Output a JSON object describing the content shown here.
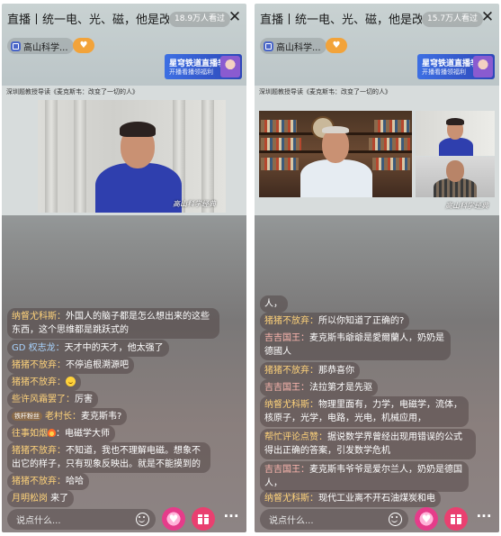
{
  "left": {
    "title": "直播丨统一电、光、磁，他是改变",
    "viewers": "18.9万人看过",
    "channel_name": "高山科学...",
    "promo": {
      "line1": "星穹铁道直播季",
      "line2": "开播看播领福利"
    },
    "video_caption": "深圳题教授导读《麦克斯韦：改变了一切的人》",
    "watermark": "高山科学经典",
    "messages": [
      {
        "user": "纳督尤科斯：",
        "text": "外国人的脑子都是怎么想出来的这些东西，这个思维都是跳跃式的",
        "color": "gold"
      },
      {
        "user": "GD 权志龙：",
        "text": "天才中的天才，他太强了",
        "color": "blue"
      },
      {
        "user": "猪猪不放弃：",
        "text": "不停追根溯源吧",
        "color": "gold"
      },
      {
        "user": "猪猪不放弃：",
        "text": "",
        "color": "gold",
        "emoji": true
      },
      {
        "user": "些许风霜罢了：",
        "text": "厉害",
        "color": "gold"
      },
      {
        "badge": "铁杆粉丝",
        "user": "老村长：",
        "text": "麦克斯韦?",
        "color": "gold"
      },
      {
        "user": "往事如烟",
        "text": "：电磁学大师",
        "color": "gold",
        "flame": true
      },
      {
        "user": "猪猪不放弃：",
        "text": "不知道，我也不理解电磁。想象不出它的样子，只有现象反映出。就是不能摸到的",
        "color": "gold"
      },
      {
        "user": "猪猪不放弃：",
        "text": "哈哈",
        "color": "gold"
      },
      {
        "user": "月明松岗",
        "text": " 来了",
        "color": "gold"
      }
    ],
    "comment_placeholder": "说点什么..."
  },
  "right": {
    "title": "直播丨统一电、光、磁，他是改变",
    "viewers": "15.7万人看过",
    "channel_name": "高山科学...",
    "promo": {
      "line1": "星穹铁道直播季",
      "line2": "开播看播领福利"
    },
    "video_caption": "深圳题教授导读《麦克斯韦：改变了一切的人》",
    "messages": [
      {
        "user": "",
        "text": "人，",
        "color": "gold"
      },
      {
        "user": "猪猪不放弃：",
        "text": "所以你知道了正确的?",
        "color": "gold"
      },
      {
        "user": "吉吉国王：",
        "text": "麦克斯韦爺爺是愛爾蘭人，奶奶是德國人",
        "color": "pink"
      },
      {
        "user": "猪猪不放弃：",
        "text": "那恭喜你",
        "color": "gold"
      },
      {
        "user": "吉吉国王：",
        "text": "法拉第才是先驱",
        "color": "pink"
      },
      {
        "user": "纳督尤科斯：",
        "text": "物理里面有，力学，电磁学，流体，核原子，光学，电路，光电，机械应用，",
        "color": "gold"
      },
      {
        "user": "帮忙评论点赞：",
        "text": "据说数学界曾经出现用错误的公式得出正确的答案，引发数学危机",
        "color": "gold"
      },
      {
        "user": "吉吉国王：",
        "text": "麦克斯韦爷爷是爱尔兰人，奶奶是德国人，",
        "color": "pink"
      },
      {
        "user": "纳督尤科斯：",
        "text": "现代工业离不开石油煤炭和电",
        "color": "gold"
      }
    ],
    "comment_placeholder": "说点什么..."
  },
  "icons": [
    "close-icon",
    "channel-badge-icon",
    "like-icon",
    "emoji-icon",
    "heart-icon",
    "gift-icon",
    "more-icon"
  ]
}
